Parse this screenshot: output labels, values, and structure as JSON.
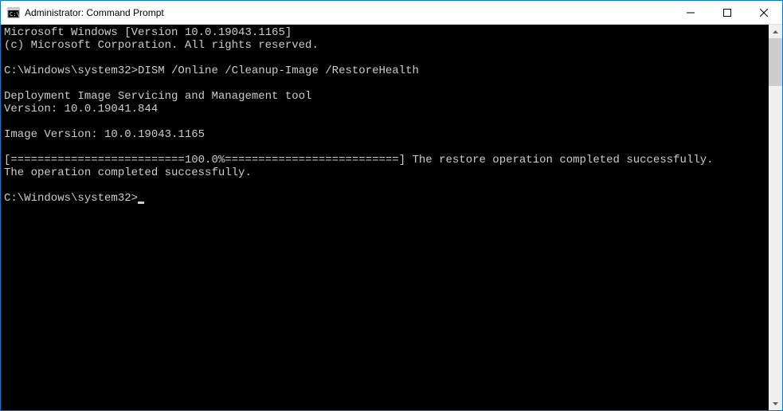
{
  "titlebar": {
    "title": "Administrator: Command Prompt"
  },
  "terminal": {
    "lines": [
      "Microsoft Windows [Version 10.0.19043.1165]",
      "(c) Microsoft Corporation. All rights reserved.",
      "",
      "C:\\Windows\\system32>DISM /Online /Cleanup-Image /RestoreHealth",
      "",
      "Deployment Image Servicing and Management tool",
      "Version: 10.0.19041.844",
      "",
      "Image Version: 10.0.19043.1165",
      "",
      "[==========================100.0%==========================] The restore operation completed successfully.",
      "The operation completed successfully.",
      ""
    ],
    "prompt": "C:\\Windows\\system32>"
  }
}
